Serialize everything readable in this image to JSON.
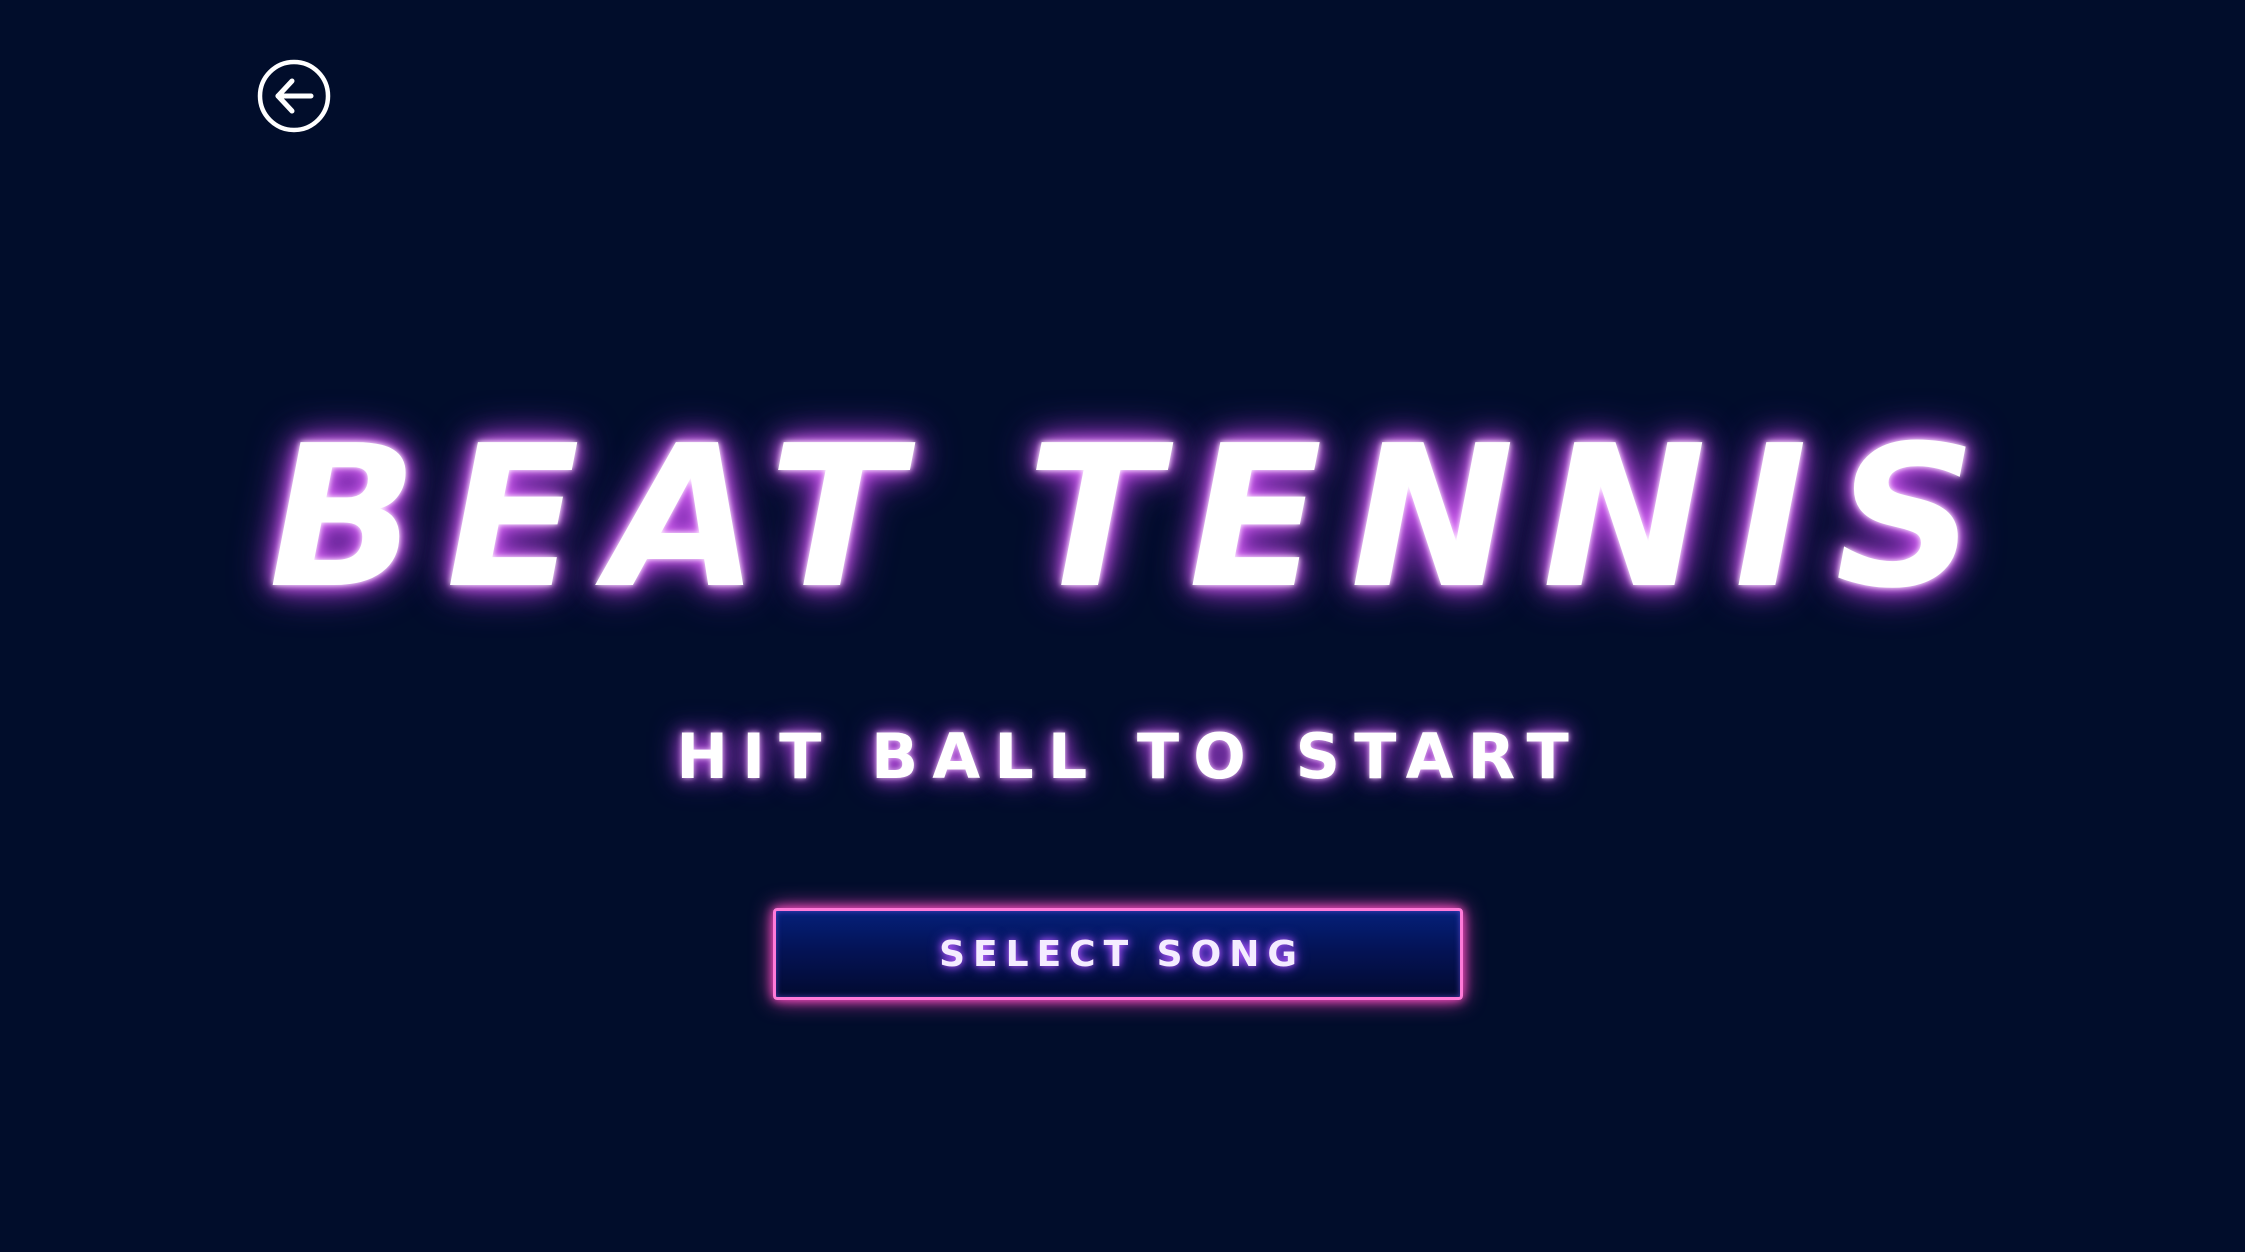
{
  "header": {
    "back_icon": "arrow-left-circle-icon"
  },
  "main": {
    "title": "BEAT TENNIS",
    "subtitle": "HIT BALL TO START",
    "select_song_label": "SELECT SONG"
  },
  "colors": {
    "background": "#010d2b",
    "title_glow": "#c34ee8",
    "button_border": "#ff7ad8",
    "button_fill": "#041356"
  }
}
